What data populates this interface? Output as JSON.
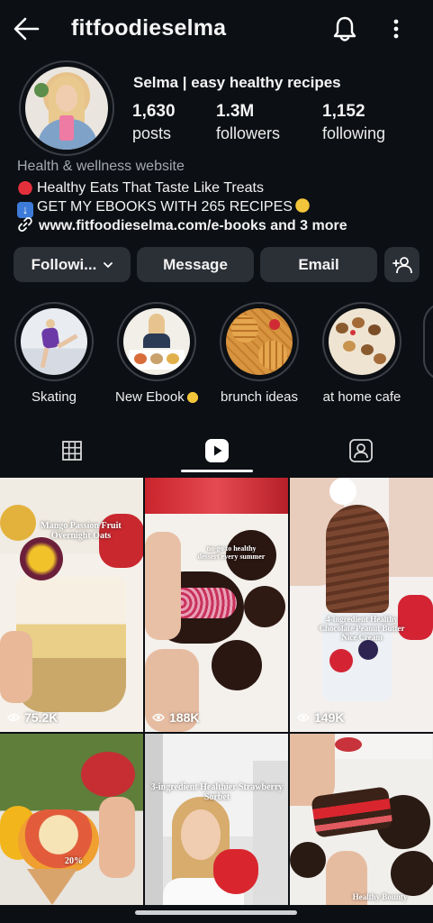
{
  "header": {
    "username": "fitfoodieselma",
    "back_icon": "arrow-left-icon",
    "notify_icon": "bell-icon",
    "menu_icon": "more-vertical-icon"
  },
  "profile": {
    "display_name": "Selma | easy healthy recipes",
    "stats": [
      {
        "value": "1,630",
        "label": "posts"
      },
      {
        "value": "1.3M",
        "label": "followers"
      },
      {
        "value": "1,152",
        "label": "following"
      }
    ],
    "category": "Health & wellness website",
    "bio": [
      "Healthy Eats That Taste Like Treats",
      "GET MY EBOOKS WITH 265 RECIPES"
    ],
    "link": "www.fitfoodieselma.com/e-books and 3 more"
  },
  "actions": {
    "following": "Followi...",
    "message": "Message",
    "email": "Email"
  },
  "highlights": [
    {
      "label": "Skating"
    },
    {
      "label": "New Ebook"
    },
    {
      "label": "brunch ideas"
    },
    {
      "label": "at home cafe"
    }
  ],
  "tabs": [
    "grid-icon",
    "reels-icon",
    "tagged-icon"
  ],
  "grid": [
    {
      "views": "75.2K",
      "caption": "Mango Passion Fruit Overnight Oats"
    },
    {
      "views": "188K",
      "caption": "no-go to healthy dessert every summer"
    },
    {
      "views": "149K",
      "caption": "4-ingredient Healthy Chocolate Peanut Butter Nice Cream"
    },
    {
      "views": "",
      "caption": "20%"
    },
    {
      "views": "",
      "caption": "3-ingredient Healthier Strawberry Sorbet"
    },
    {
      "views": "",
      "caption": "Healthy Bounty"
    }
  ],
  "colors": {
    "background": "#0c0f14",
    "button": "#2b2f36",
    "muted_text": "#a4a8b0"
  }
}
